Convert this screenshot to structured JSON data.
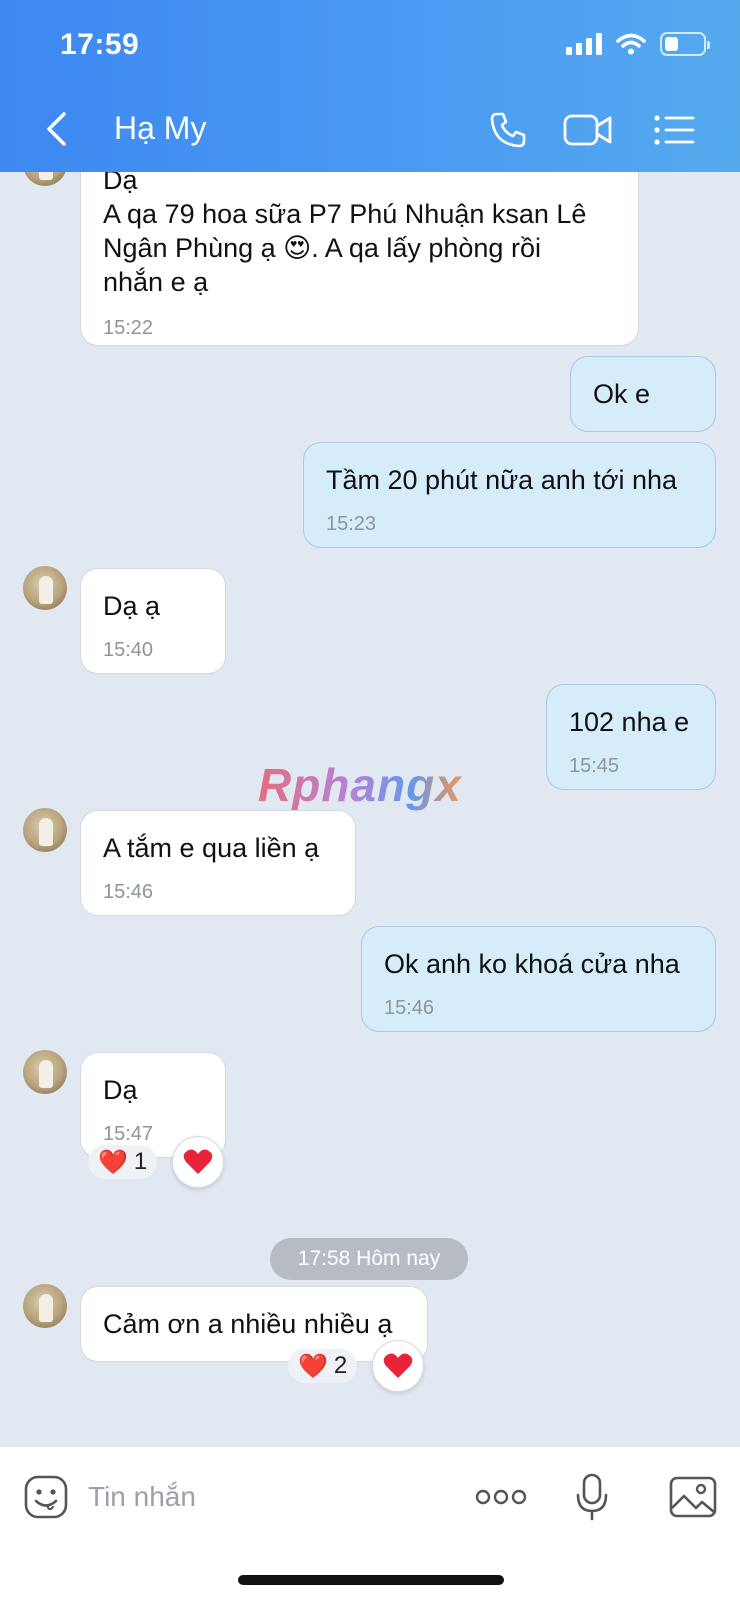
{
  "status_bar": {
    "time": "17:59",
    "battery_level": 0.35
  },
  "header": {
    "contact_name": "Hạ My",
    "icons": [
      "chevron-left-icon",
      "phone-icon",
      "video-call-icon",
      "menu-list-icon"
    ]
  },
  "messages": [
    {
      "dir": "in",
      "lines": [
        "Dạ",
        "A qa 79 hoa sữa P7 Phú Nhuận ksan Lê",
        "Ngân Phùng ạ 😍. A qa lấy phòng rồi",
        "nhắn e ạ"
      ],
      "time": "15:22"
    },
    {
      "dir": "out",
      "text": "Ok e"
    },
    {
      "dir": "out",
      "text": "Tầm 20 phút nữa anh tới nha",
      "time": "15:23"
    },
    {
      "dir": "in",
      "text": "Dạ ạ",
      "time": "15:40"
    },
    {
      "dir": "out",
      "text": "102 nha e",
      "time": "15:45"
    },
    {
      "dir": "in",
      "text": "A tắm e qua liền ạ",
      "time": "15:46"
    },
    {
      "dir": "out",
      "text": "Ok anh ko khoá cửa nha",
      "time": "15:46"
    },
    {
      "dir": "in",
      "text": "Dạ",
      "time": "15:47",
      "reaction": {
        "emoji": "❤️",
        "count": "1"
      }
    },
    {
      "dir": "in",
      "text": "Cảm ơn a nhiều nhiều ạ",
      "reaction": {
        "emoji": "❤️",
        "count": "2"
      }
    }
  ],
  "date_separator": "17:58 Hôm nay",
  "watermark": "Rphangx",
  "composer": {
    "placeholder": "Tin nhắn",
    "icons": [
      "sticker-icon",
      "more-icon",
      "microphone-icon",
      "image-icon"
    ]
  }
}
